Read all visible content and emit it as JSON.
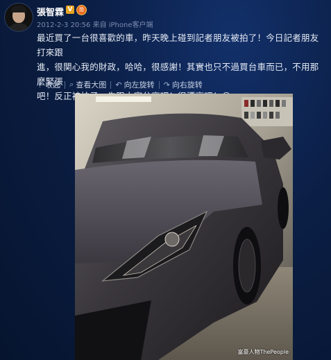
{
  "post": {
    "author": "張智霖",
    "verified_badge": "V",
    "medal_badge": "勋",
    "meta": "2012-2-3 20:56 来自 iPhone客户端",
    "text_line1": "最近買了一台很喜歡的車，昨天晚上碰到記者朋友被拍了！今日記者朋友打來跟",
    "text_line2": "進，很関心我的財政，哈哈，很感謝！其實也只不過買台車而已，不用那麼緊張",
    "text_line3": "吧！反正被拍子，先跟大家分享吧！很漂亮吧！☺"
  },
  "toolbar": {
    "collapse": "收起",
    "view_large": "查看大图",
    "rotate_left": "向左旋转",
    "rotate_right": "向右旋转"
  },
  "icons": {
    "collapse": "arrow-up-icon",
    "view_large": "magnifier-icon",
    "rotate_left": "rotate-left-icon",
    "rotate_right": "rotate-right-icon"
  },
  "photo": {
    "watermark": "富豪人物ThePeople"
  },
  "colors": {
    "background": "#0b1e44",
    "text": "#e6ebf5",
    "meta": "#7d8bad",
    "badge": "#e8a321"
  }
}
